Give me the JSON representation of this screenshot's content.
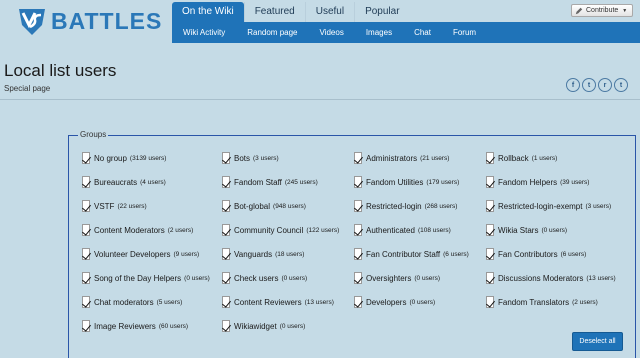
{
  "logo": {
    "text": "BATTLES",
    "icon": "shield-vs-icon"
  },
  "nav": {
    "tabs": [
      "On the Wiki",
      "Featured",
      "Useful",
      "Popular"
    ],
    "active_tab": "On the Wiki",
    "sub_items": [
      "Wiki Activity",
      "Random page",
      "Videos",
      "Images",
      "Chat",
      "Forum"
    ]
  },
  "contribute": {
    "label": "Contribute",
    "icon": "pencil-icon"
  },
  "page": {
    "title": "Local list users",
    "subtitle": "Special page"
  },
  "share": [
    {
      "icon": "facebook-icon",
      "glyph": "f"
    },
    {
      "icon": "twitter-icon",
      "glyph": "t"
    },
    {
      "icon": "reddit-icon",
      "glyph": "r"
    },
    {
      "icon": "tumblr-icon",
      "glyph": "t"
    }
  ],
  "groups": {
    "legend": "Groups",
    "items": [
      {
        "name": "No group",
        "count": "(3139 users)"
      },
      {
        "name": "Bots",
        "count": "(3 users)"
      },
      {
        "name": "Administrators",
        "count": "(21 users)"
      },
      {
        "name": "Rollback",
        "count": "(1 users)"
      },
      {
        "name": "Bureaucrats",
        "count": "(4 users)"
      },
      {
        "name": "Fandom Staff",
        "count": "(245 users)"
      },
      {
        "name": "Fandom Utilities",
        "count": "(179 users)"
      },
      {
        "name": "Fandom Helpers",
        "count": "(39 users)"
      },
      {
        "name": "VSTF",
        "count": "(22 users)"
      },
      {
        "name": "Bot-global",
        "count": "(948 users)"
      },
      {
        "name": "Restricted-login",
        "count": "(268 users)"
      },
      {
        "name": "Restricted-login-exempt",
        "count": "(3 users)"
      },
      {
        "name": "Content Moderators",
        "count": "(2 users)"
      },
      {
        "name": "Community Council",
        "count": "(122 users)"
      },
      {
        "name": "Authenticated",
        "count": "(108 users)"
      },
      {
        "name": "Wikia Stars",
        "count": "(0 users)"
      },
      {
        "name": "Volunteer Developers",
        "count": "(9 users)"
      },
      {
        "name": "Vanguards",
        "count": "(18 users)"
      },
      {
        "name": "Fan Contributor Staff",
        "count": "(6 users)"
      },
      {
        "name": "Fan Contributors",
        "count": "(6 users)"
      },
      {
        "name": "Song of the Day Helpers",
        "count": "(0 users)"
      },
      {
        "name": "Check users",
        "count": "(0 users)"
      },
      {
        "name": "Oversighters",
        "count": "(0 users)"
      },
      {
        "name": "Discussions Moderators",
        "count": "(13 users)"
      },
      {
        "name": "Chat moderators",
        "count": "(5 users)"
      },
      {
        "name": "Content Reviewers",
        "count": "(13 users)"
      },
      {
        "name": "Developers",
        "count": "(0 users)"
      },
      {
        "name": "Fandom Translators",
        "count": "(2 users)"
      },
      {
        "name": "Image Reviewers",
        "count": "(60 users)"
      },
      {
        "name": "Wikiawidget",
        "count": "(0 users)"
      }
    ]
  },
  "deselect_label": "Deselect all",
  "colors": {
    "accent": "#1f73b8",
    "background": "#c5dbe6",
    "brand": "#2b78b8"
  }
}
